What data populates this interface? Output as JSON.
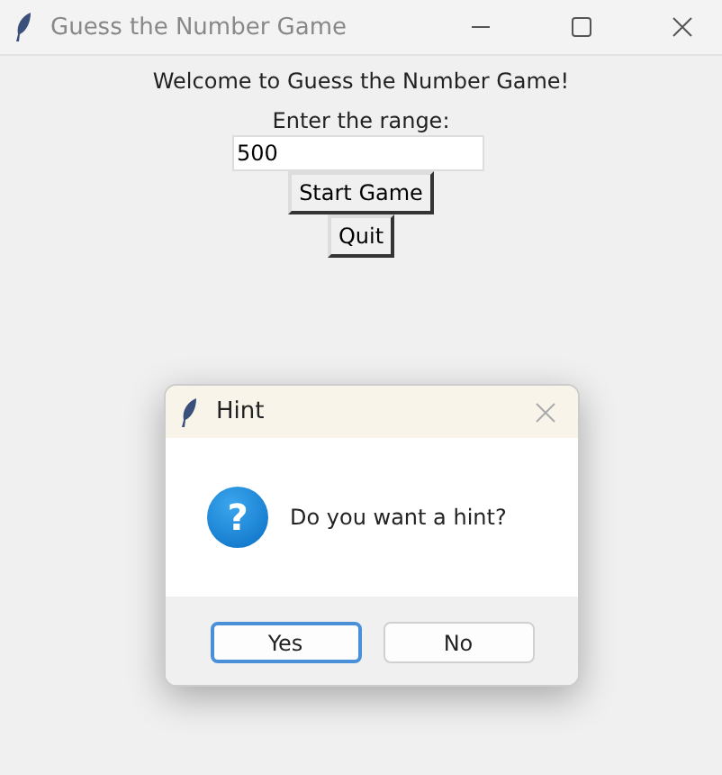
{
  "window": {
    "title": "Guess the Number Game"
  },
  "welcome": "Welcome to Guess the Number Game!",
  "range_label": "Enter the range:",
  "range_field": {
    "value": "500"
  },
  "buttons": [
    "Start Game",
    "Quit"
  ],
  "dialog": {
    "title": "Hint",
    "icon": "?",
    "message": "Do you want a hint?",
    "buttons": [
      {
        "label": "Yes",
        "focused": true
      },
      {
        "label": "No",
        "focused": false
      }
    ]
  }
}
